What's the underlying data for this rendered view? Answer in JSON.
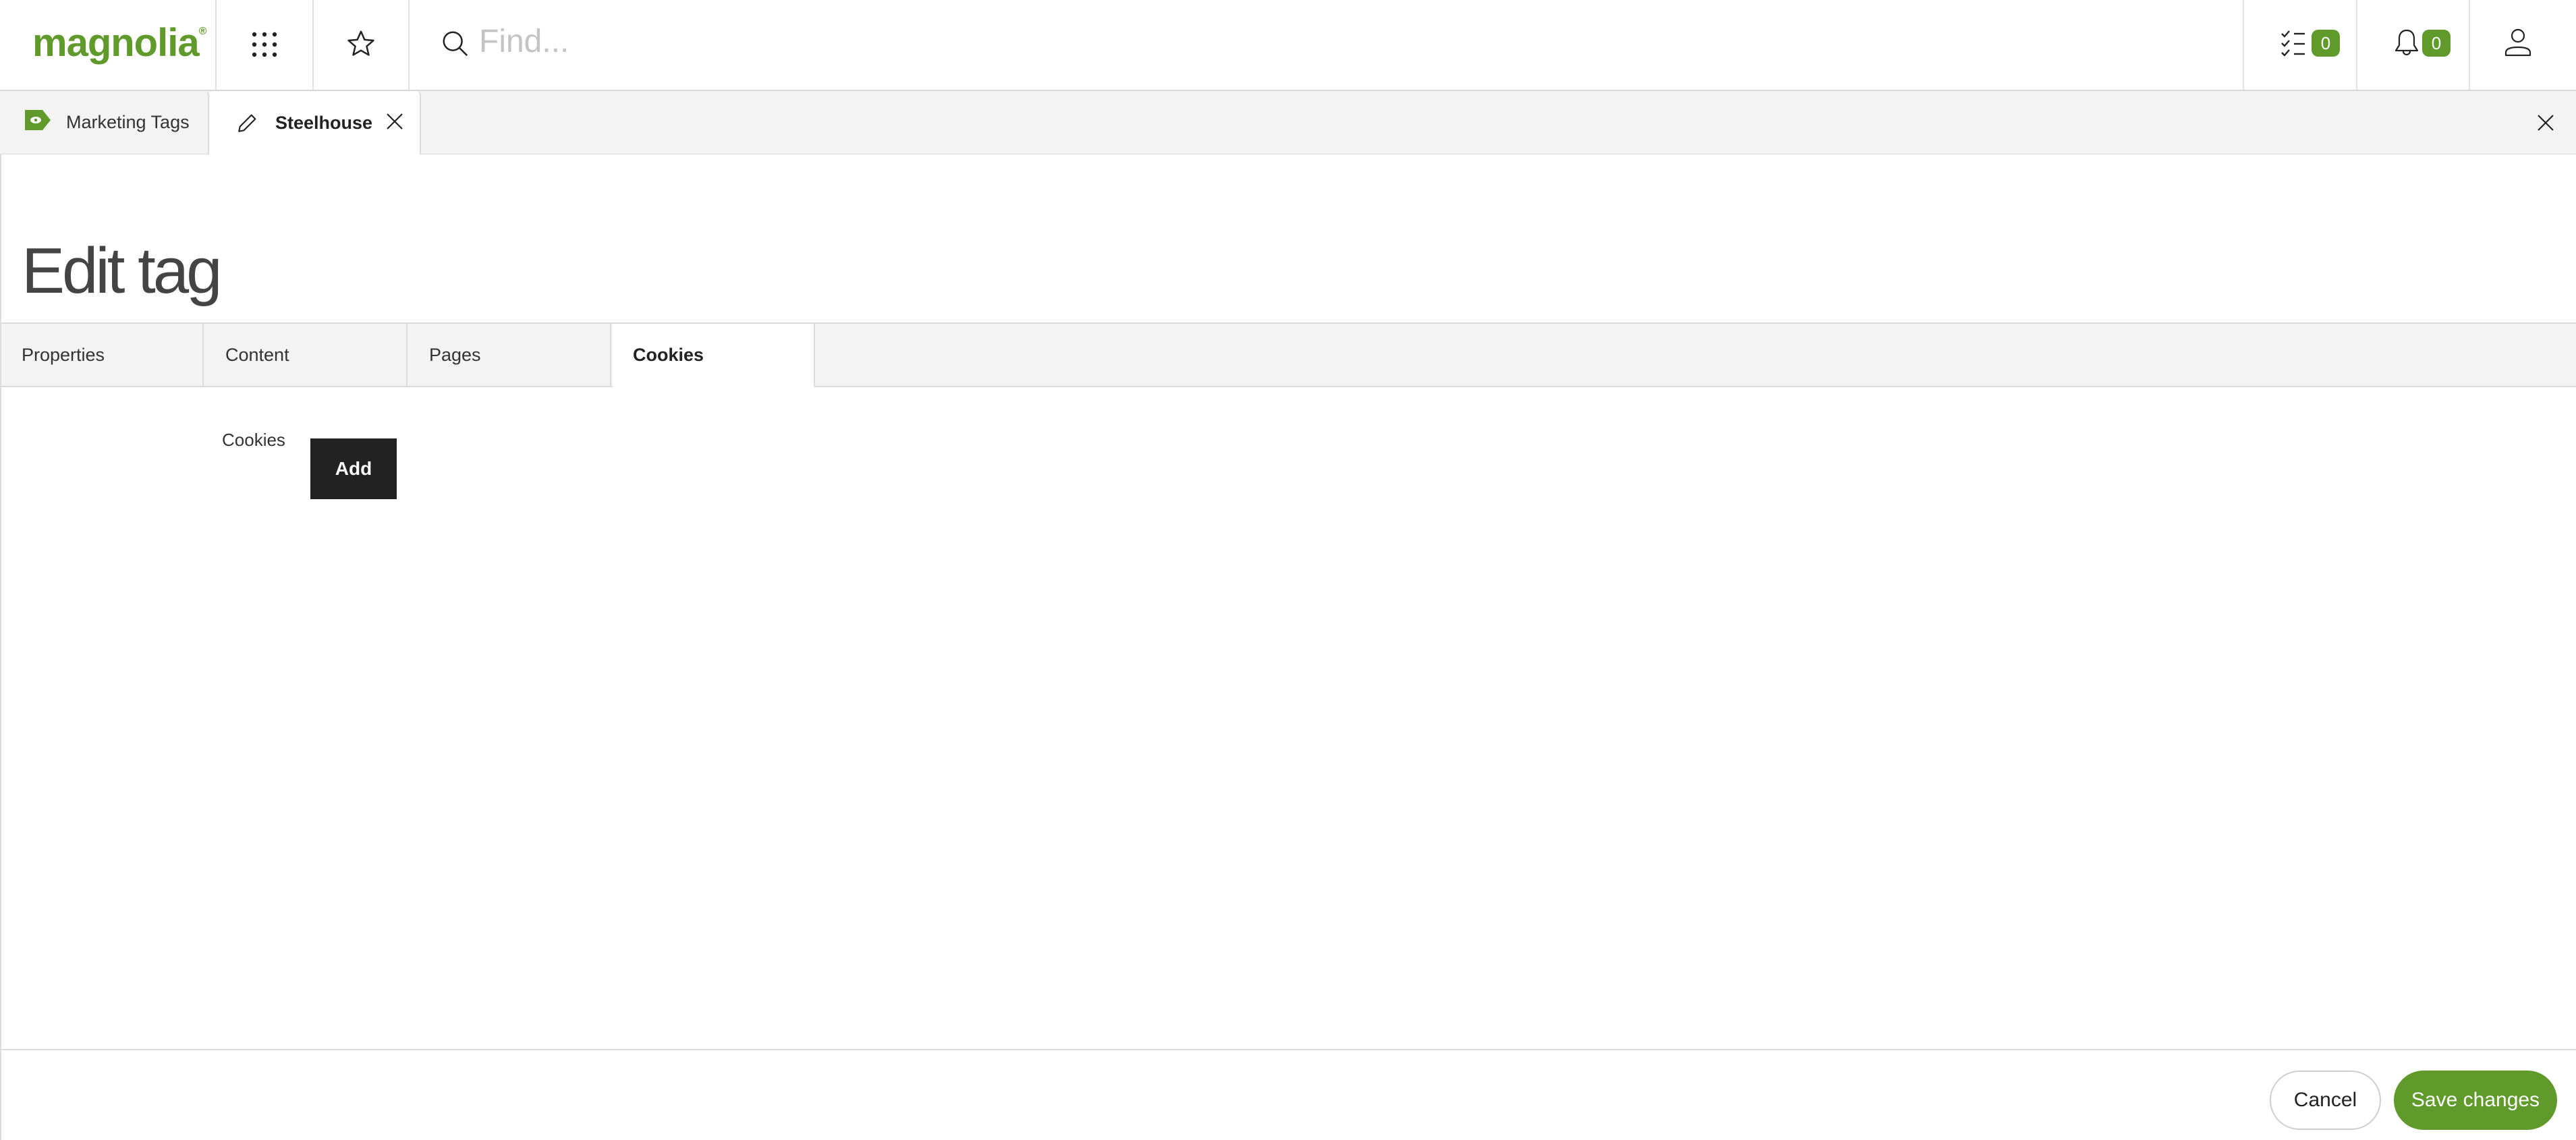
{
  "header": {
    "logo": "magnolia",
    "logo_mark": "®",
    "search_placeholder": "Find...",
    "icons": [
      "app-launcher-icon",
      "favorites-star-icon",
      "search-icon",
      "tasks-icon",
      "notifications-bell-icon",
      "user-icon"
    ],
    "tasks_count": "0",
    "notifications_count": "0"
  },
  "app_tabs": [
    {
      "label": "Marketing Tags",
      "icon": "marketing-tags-icon",
      "active": false
    },
    {
      "label": "Steelhouse",
      "icon": "pencil-icon",
      "active": true,
      "closable": true
    }
  ],
  "page": {
    "title": "Edit tag",
    "tabs": [
      {
        "label": "Properties",
        "active": false
      },
      {
        "label": "Content",
        "active": false
      },
      {
        "label": "Pages",
        "active": false
      },
      {
        "label": "Cookies",
        "active": true
      }
    ],
    "cookies_field": {
      "label": "Cookies",
      "add_button": "Add"
    }
  },
  "footer": {
    "cancel": "Cancel",
    "save": "Save changes"
  },
  "colors": {
    "brand": "#5f9a2b",
    "dark_button": "#222222"
  }
}
